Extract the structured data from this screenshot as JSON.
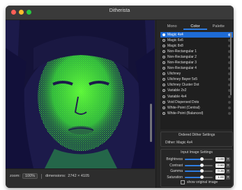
{
  "window": {
    "title": "Ditherista"
  },
  "tabs": [
    {
      "label": "Mono",
      "active": false
    },
    {
      "label": "Color",
      "active": true
    },
    {
      "label": "Palette",
      "active": false
    }
  ],
  "algorithms": [
    {
      "label": "Magic 4x4",
      "selected": true
    },
    {
      "label": "Magic 6x6",
      "selected": false
    },
    {
      "label": "Magic 8x8",
      "selected": false
    },
    {
      "label": "Non-Rectangular 1",
      "selected": false
    },
    {
      "label": "Non-Rectangular 2",
      "selected": false
    },
    {
      "label": "Non-Rectangular 3",
      "selected": false
    },
    {
      "label": "Non-Rectangular 4",
      "selected": false
    },
    {
      "label": "Ulichney",
      "selected": false
    },
    {
      "label": "Ulichney Bayer 5x5",
      "selected": false
    },
    {
      "label": "Ulichney Cluster Dot",
      "selected": false
    },
    {
      "label": "Variable 2x2",
      "selected": false
    },
    {
      "label": "Variable 4x4",
      "selected": false
    },
    {
      "label": "Void Dispersed Dots",
      "selected": false
    },
    {
      "label": "White-Point (Central)",
      "selected": false
    },
    {
      "label": "White-Point (Balanced)",
      "selected": false
    }
  ],
  "ordered_settings": {
    "title": "Ordered Dither Settings",
    "dither_label": "Dither:",
    "dither_value": "Magic 4x4"
  },
  "input_settings": {
    "title": "Input Image Settings",
    "sliders": [
      {
        "label": "Brightness",
        "value": "0.00",
        "level": 0.62
      },
      {
        "label": "Contrast",
        "value": "0.80",
        "level": 0.6
      },
      {
        "label": "Gamma",
        "value": "0.36",
        "level": 0.62
      },
      {
        "label": "Saturation",
        "value": "1.00",
        "level": 0.62
      }
    ],
    "reset_symbol": "×",
    "show_original_label": "show original image"
  },
  "status": {
    "zoom_label": "zoom:",
    "zoom_value": "100%",
    "dimensions_label": "dimensions:",
    "dimensions_value": "2742 × 4105"
  },
  "colors": {
    "accent": "#2f7de0",
    "image_dark": "#1c1a4a",
    "image_light": "#3ad83a"
  }
}
